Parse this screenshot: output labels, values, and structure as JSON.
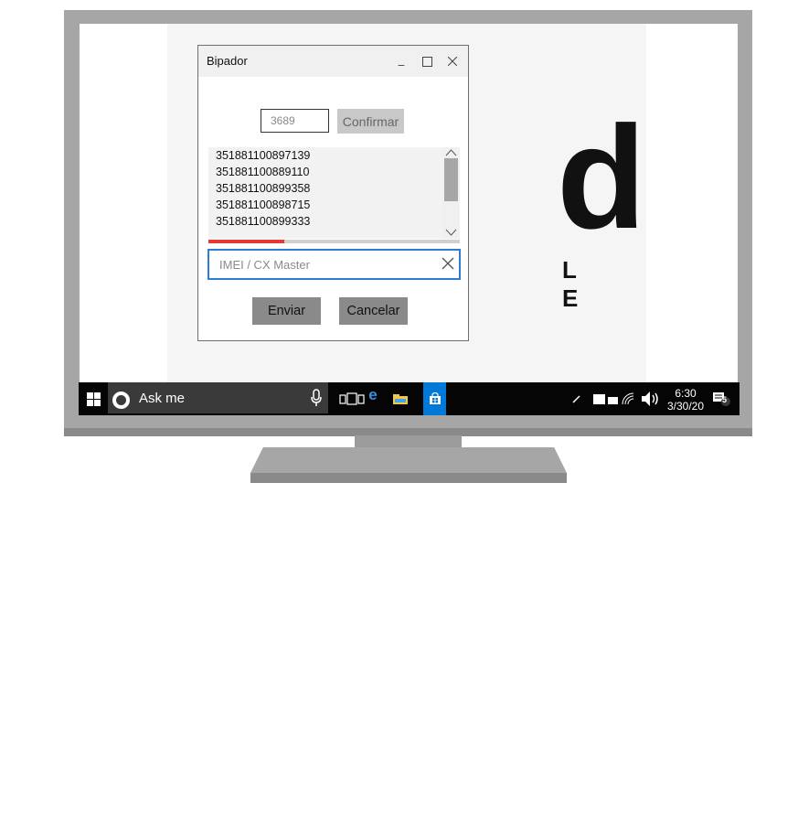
{
  "wallpaper": {
    "logo_letter": "d",
    "logo_subtext": "L E"
  },
  "dialog": {
    "title": "Bipador",
    "minimize_label": "_",
    "code_input_value": "3689",
    "confirm_label": "Confirmar",
    "list_items": [
      "351881100897139",
      "351881100889110",
      "351881100899358",
      "351881100898715",
      "351881100899333"
    ],
    "progress_fraction": 0.3,
    "progress_color": "#e53935",
    "imei_placeholder": "IMEI / CX Master",
    "send_label": "Enviar",
    "cancel_label": "Cancelar"
  },
  "taskbar": {
    "search_text": "Ask me",
    "time": "6:30",
    "date": "3/30/20",
    "notification_count": "5",
    "store_color": "#0078d7",
    "icons": [
      "windows-icon",
      "cortana-icon",
      "microphone-icon",
      "task-view-icon",
      "edge-icon",
      "file-explorer-icon",
      "store-icon",
      "pen-icon",
      "battery-icon",
      "wifi-icon",
      "volume-icon",
      "action-center-icon"
    ]
  }
}
